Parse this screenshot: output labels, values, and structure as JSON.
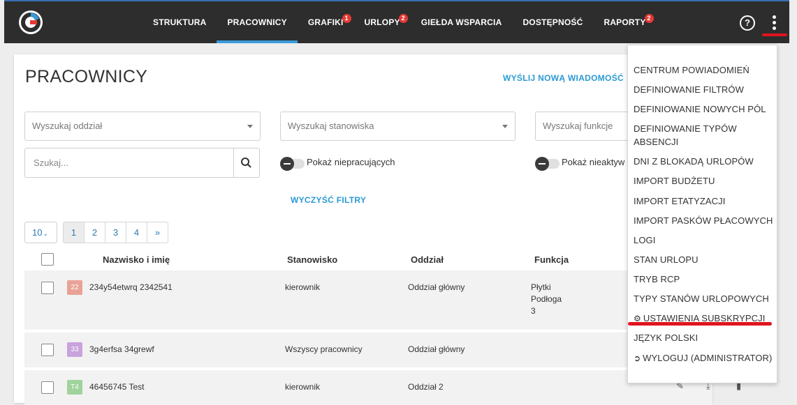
{
  "nav": {
    "items": [
      {
        "label": "STRUKTURA",
        "badge": ""
      },
      {
        "label": "PRACOWNICY",
        "badge": "",
        "active": true
      },
      {
        "label": "GRAFIKI",
        "badge": "1"
      },
      {
        "label": "URLOPY",
        "badge": "2"
      },
      {
        "label": "GIEŁDA WSPARCIA",
        "badge": ""
      },
      {
        "label": "DOSTĘPNOŚĆ",
        "badge": ""
      },
      {
        "label": "RAPORTY",
        "badge": "2"
      }
    ],
    "help_icon": "question-circle",
    "menu_icon": "kebab-vertical"
  },
  "page": {
    "title": "PRACOWNICY",
    "send_message_link": "WYŚLIJ NOWĄ WIADOMOŚĆ"
  },
  "filters": {
    "department_placeholder": "Wyszukaj oddział",
    "position_placeholder": "Wyszukaj stanowiska",
    "function_placeholder": "Wyszukaj funkcje",
    "search_placeholder": "Szukaj...",
    "show_not_working_label": "Pokaż niepracujących",
    "show_inactive_label": "Pokaż nieaktyw",
    "clear_filters_label": "WYCZYŚĆ FILTRY"
  },
  "pagination": {
    "per_page": "10",
    "pages": [
      "1",
      "2",
      "3",
      "4",
      "»"
    ],
    "current": "1"
  },
  "table": {
    "headers": {
      "name": "Nazwisko i imię",
      "position": "Stanowisko",
      "department": "Oddział",
      "function": "Funkcja"
    },
    "rows": [
      {
        "badge": "22",
        "badge_color": "#e8a396",
        "name": "234y54etwrq 2342541",
        "position": "kierownik",
        "department": "Oddział główny",
        "function_lines": [
          "Płytki",
          "Podłoga",
          "3"
        ]
      },
      {
        "badge": "33",
        "badge_color": "#c8a3dc",
        "name": "3g4erfsa 34grewf",
        "position": "Wszyscy pracownicy",
        "department": "Oddział główny",
        "function_lines": []
      },
      {
        "badge": "T4",
        "badge_color": "#9fd39b",
        "name": "46456745 Test",
        "position": "kierownik",
        "department": "Oddział 2",
        "function_lines": []
      }
    ]
  },
  "dropdown_menu": {
    "items": [
      "CENTRUM POWIADOMIEŃ",
      "DEFINIOWANIE FILTRÓW",
      "DEFINIOWANIE NOWYCH PÓL",
      "DEFINIOWANIE TYPÓW ABSENCJI",
      "DNI Z BLOKADĄ URLOPÓW",
      "IMPORT BUDŻETU",
      "IMPORT ETATYZACJI",
      "IMPORT PASKÓW PŁACOWYCH",
      "LOGI",
      "STAN URLOPU",
      "TRYB RCP",
      "TYPY STANÓW URLOPOWYCH",
      "USTAWIENIA SUBSKRYPCJI",
      "JĘZYK POLSKI",
      "WYLOGUJ (ADMINISTRATOR)"
    ],
    "icons": {
      "subscription": "gear-icon",
      "logout": "logout-icon"
    }
  },
  "colors": {
    "topbar": "#2d2d2d",
    "accent": "#2a9ad3",
    "highlight_red": "#e0141e",
    "badge_red": "#e53935"
  }
}
